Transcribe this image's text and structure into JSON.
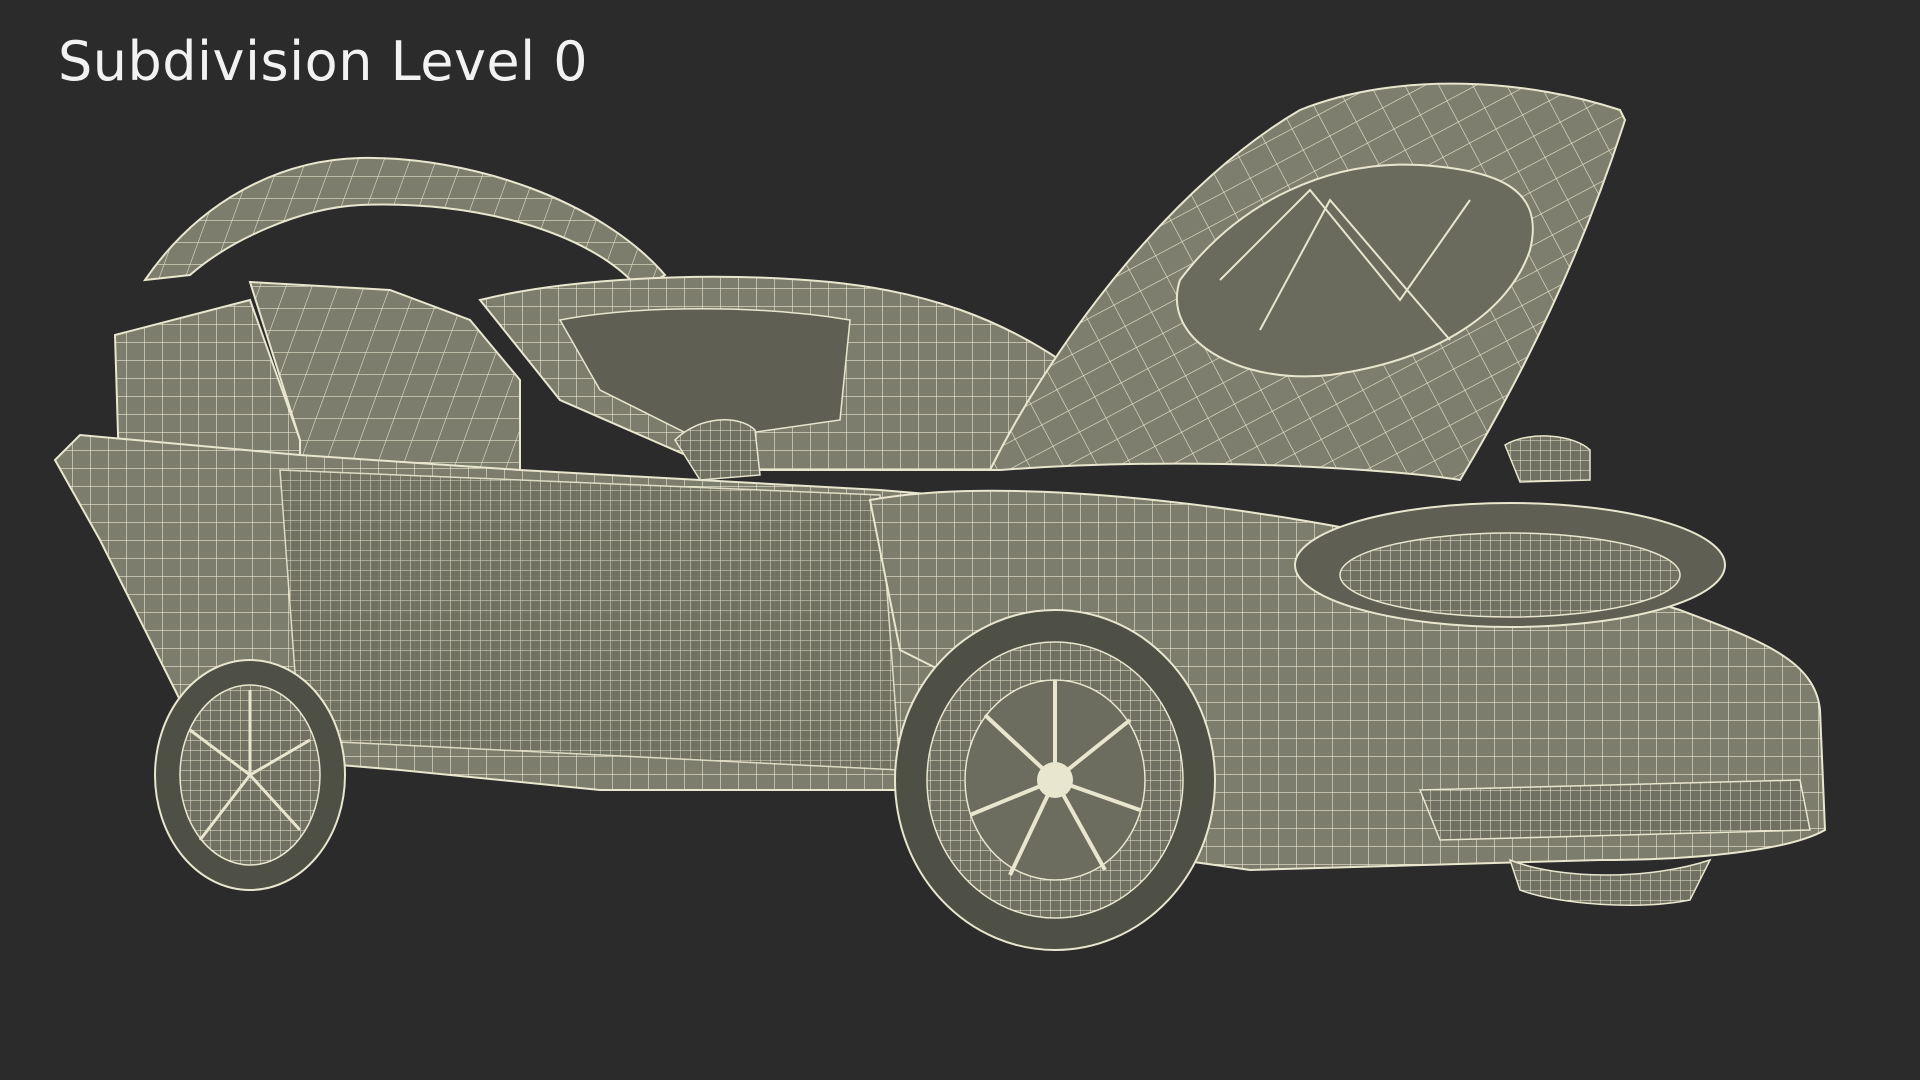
{
  "caption": "Subdivision Level 0",
  "colors": {
    "background": "#2b2b2b",
    "surface": "#7c7d6c",
    "surface_dark": "#5f6053",
    "wire": "#e9e6cf",
    "caption_text": "#f2f2f2"
  }
}
